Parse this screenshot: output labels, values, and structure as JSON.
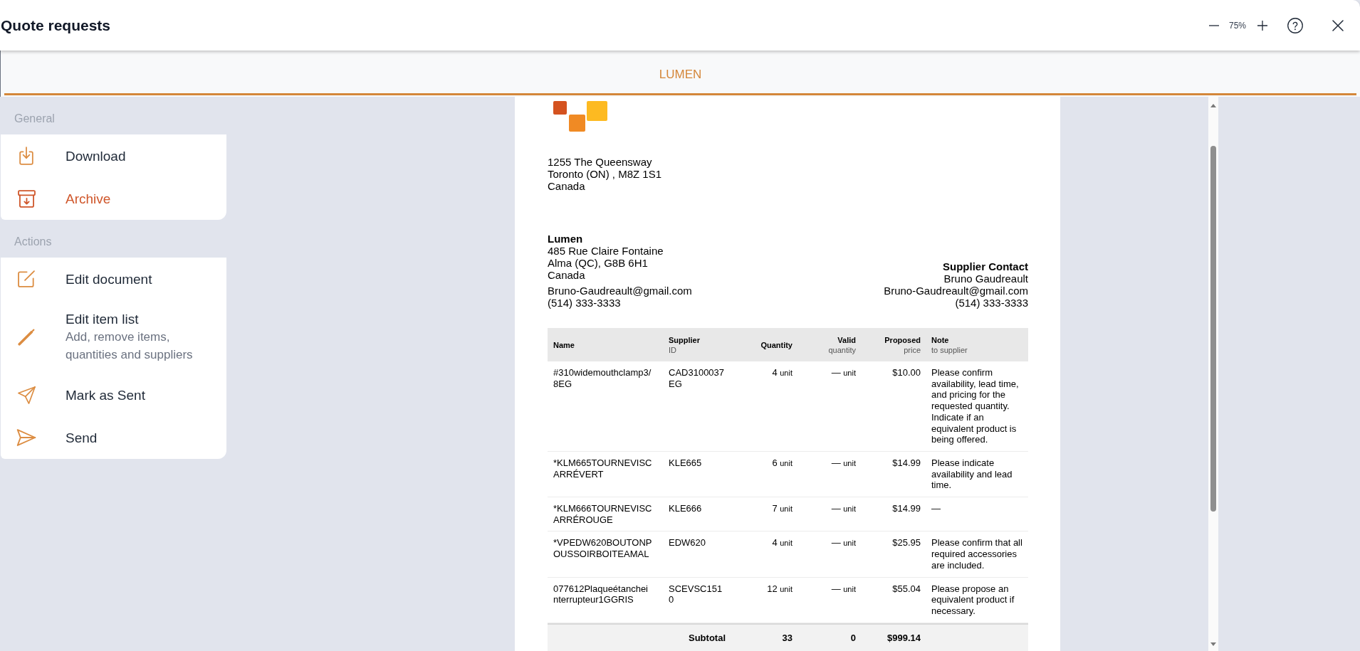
{
  "window": {
    "title": "Quote requests"
  },
  "toolbar": {
    "zoom_level": "75%"
  },
  "tabs": [
    {
      "label": "LUMEN",
      "selected": true
    }
  ],
  "sidebar": {
    "sections": [
      {
        "title": "General",
        "items": [
          {
            "label": "Download",
            "danger": false
          },
          {
            "label": "Archive",
            "danger": true
          }
        ]
      },
      {
        "title": "Actions",
        "items": [
          {
            "label": "Edit document",
            "danger": false
          },
          {
            "label": "Edit item list",
            "description": "Add, remove items, quantities and suppliers",
            "danger": false
          },
          {
            "label": "Mark as Sent",
            "danger": false
          },
          {
            "label": "Send",
            "danger": false
          }
        ]
      }
    ]
  },
  "document": {
    "sender_address": [
      "1255 The Queensway",
      "Toronto (ON) , M8Z 1S1",
      "Canada"
    ],
    "supplier": {
      "name": "Lumen",
      "address": [
        "485 Rue Claire Fontaine",
        "Alma (QC), G8B 6H1",
        "Canada"
      ],
      "email": "Bruno-Gaudreault@gmail.com",
      "phone": "(514) 333-3333"
    },
    "supplier_contact": {
      "title": "Supplier Contact",
      "name": "Bruno Gaudreault",
      "email": "Bruno-Gaudreault@gmail.com",
      "phone": "(514) 333-3333"
    },
    "table": {
      "columns": [
        {
          "label": "Name"
        },
        {
          "label": "Supplier",
          "sublabel": "ID"
        },
        {
          "label": "Quantity"
        },
        {
          "label": "Valid",
          "sublabel": "quantity"
        },
        {
          "label": "Proposed",
          "sublabel": "price"
        },
        {
          "label": "Note",
          "sublabel": "to supplier"
        }
      ],
      "rows": [
        {
          "name": "#310widemouthclamp3/8EG",
          "supplier_id": "CAD3100037EG",
          "quantity": "4",
          "quantity_unit": "unit",
          "valid_quantity": "—",
          "valid_unit": "unit",
          "proposed_price": "$10.00",
          "note": "Please confirm availability, lead time, and pricing for the requested quantity. Indicate if an equivalent product is being offered."
        },
        {
          "name": "*KLM665TOURNEVISCARRÉVERT",
          "supplier_id": "KLE665",
          "quantity": "6",
          "quantity_unit": "unit",
          "valid_quantity": "—",
          "valid_unit": "unit",
          "proposed_price": "$14.99",
          "note": "Please indicate availability and lead time."
        },
        {
          "name": "*KLM666TOURNEVISCARRÉROUGE",
          "supplier_id": "KLE666",
          "quantity": "7",
          "quantity_unit": "unit",
          "valid_quantity": "—",
          "valid_unit": "unit",
          "proposed_price": "$14.99",
          "note": "—"
        },
        {
          "name": "*VPEDW620BOUTONPOUSSOIRBOITEAMAL",
          "supplier_id": "EDW620",
          "quantity": "4",
          "quantity_unit": "unit",
          "valid_quantity": "—",
          "valid_unit": "unit",
          "proposed_price": "$25.95",
          "note": "Please confirm that all required accessories are included."
        },
        {
          "name": "077612Plaqueétancheinterrupteur1GGRIS",
          "supplier_id": "SCEVSC1510",
          "quantity": "12",
          "quantity_unit": "unit",
          "valid_quantity": "—",
          "valid_unit": "unit",
          "proposed_price": "$55.04",
          "note": "Please propose an equivalent product if necessary."
        }
      ],
      "subtotal": {
        "label": "Subtotal",
        "quantity": "33",
        "valid_quantity": "0",
        "proposed_price": "$999.14"
      }
    }
  }
}
